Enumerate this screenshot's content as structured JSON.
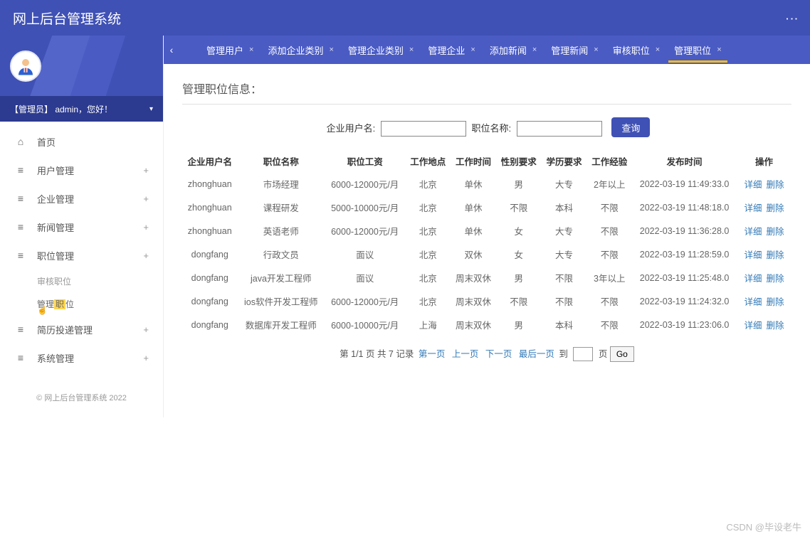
{
  "header": {
    "title": "网上后台管理系统"
  },
  "user_bar": {
    "text": "【管理员】 admin，您好！"
  },
  "sidebar": {
    "items": [
      {
        "icon": "⌂",
        "label": "首页",
        "expandable": false
      },
      {
        "icon": "≡",
        "label": "用户管理",
        "expandable": true
      },
      {
        "icon": "≡",
        "label": "企业管理",
        "expandable": true
      },
      {
        "icon": "≡",
        "label": "新闻管理",
        "expandable": true
      },
      {
        "icon": "≡",
        "label": "职位管理",
        "expandable": true,
        "children": [
          {
            "label": "审核职位"
          },
          {
            "label_pre": "管理",
            "label_hl": "职",
            "label_post": "位",
            "highlighted": true
          }
        ]
      },
      {
        "icon": "≡",
        "label": "简历投递管理",
        "expandable": true
      },
      {
        "icon": "≡",
        "label": "系统管理",
        "expandable": true
      }
    ],
    "footer": "© 网上后台管理系统 2022"
  },
  "tabs": [
    {
      "label": "管理用户"
    },
    {
      "label": "添加企业类别"
    },
    {
      "label": "管理企业类别"
    },
    {
      "label": "管理企业"
    },
    {
      "label": "添加新闻"
    },
    {
      "label": "管理新闻"
    },
    {
      "label": "审核职位"
    },
    {
      "label": "管理职位",
      "active": true
    }
  ],
  "content": {
    "title": "管理职位信息：",
    "search": {
      "label1": "企业用户名:",
      "label2": "职位名称:",
      "button": "查询"
    },
    "columns": [
      "企业用户名",
      "职位名称",
      "职位工资",
      "工作地点",
      "工作时间",
      "性别要求",
      "学历要求",
      "工作经验",
      "发布时间",
      "操作"
    ],
    "rows": [
      [
        "zhonghuan",
        "市场经理",
        "6000-12000元/月",
        "北京",
        "单休",
        "男",
        "大专",
        "2年以上",
        "2022-03-19 11:49:33.0"
      ],
      [
        "zhonghuan",
        "课程研发",
        "5000-10000元/月",
        "北京",
        "单休",
        "不限",
        "本科",
        "不限",
        "2022-03-19 11:48:18.0"
      ],
      [
        "zhonghuan",
        "英语老师",
        "6000-12000元/月",
        "北京",
        "单休",
        "女",
        "大专",
        "不限",
        "2022-03-19 11:36:28.0"
      ],
      [
        "dongfang",
        "行政文员",
        "面议",
        "北京",
        "双休",
        "女",
        "大专",
        "不限",
        "2022-03-19 11:28:59.0"
      ],
      [
        "dongfang",
        "java开发工程师",
        "面议",
        "北京",
        "周末双休",
        "男",
        "不限",
        "3年以上",
        "2022-03-19 11:25:48.0"
      ],
      [
        "dongfang",
        "ios软件开发工程师",
        "6000-12000元/月",
        "北京",
        "周末双休",
        "不限",
        "不限",
        "不限",
        "2022-03-19 11:24:32.0"
      ],
      [
        "dongfang",
        "数据库开发工程师",
        "6000-10000元/月",
        "上海",
        "周末双休",
        "男",
        "本科",
        "不限",
        "2022-03-19 11:23:06.0"
      ]
    ],
    "actions": {
      "detail": "详细",
      "delete": "删除"
    },
    "pager": {
      "text": "第 1/1 页 共 7 记录",
      "first": "第一页",
      "prev": "上一页",
      "next": "下一页",
      "last": "最后一页",
      "to": "到",
      "page_suffix": "页",
      "go": "Go"
    }
  },
  "watermark": "CSDN @毕设老牛"
}
